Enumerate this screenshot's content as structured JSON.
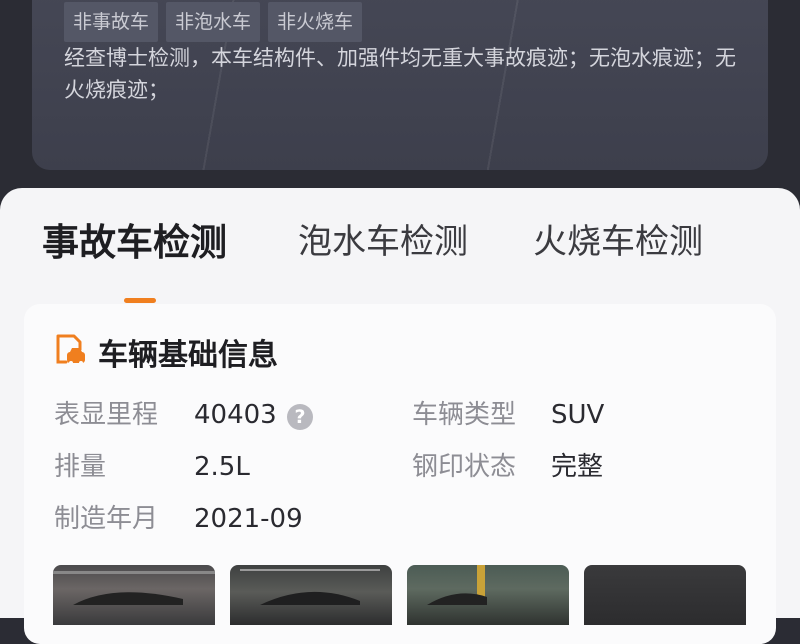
{
  "top": {
    "tags": [
      "非事故车",
      "非泡水车",
      "非火烧车"
    ],
    "description": "经查博士检测，本车结构件、加强件均无重大事故痕迹；无泡水痕迹；无火烧痕迹；"
  },
  "tabs": [
    {
      "label": "事故车检测",
      "active": true
    },
    {
      "label": "泡水车检测",
      "active": false
    },
    {
      "label": "火烧车检测",
      "active": false
    }
  ],
  "accent_color": "#f07f1f",
  "card": {
    "title": "车辆基础信息",
    "icon": "vehicle-document-icon",
    "fields": {
      "mileage_label": "表显里程",
      "mileage_value": "40403",
      "type_label": "车辆类型",
      "type_value": "SUV",
      "displacement_label": "排量",
      "displacement_value": "2.5L",
      "stamp_label": "钢印状态",
      "stamp_value": "完整",
      "date_label": "制造年月",
      "date_value": "2021-09"
    }
  },
  "photos_count_visible": 4
}
